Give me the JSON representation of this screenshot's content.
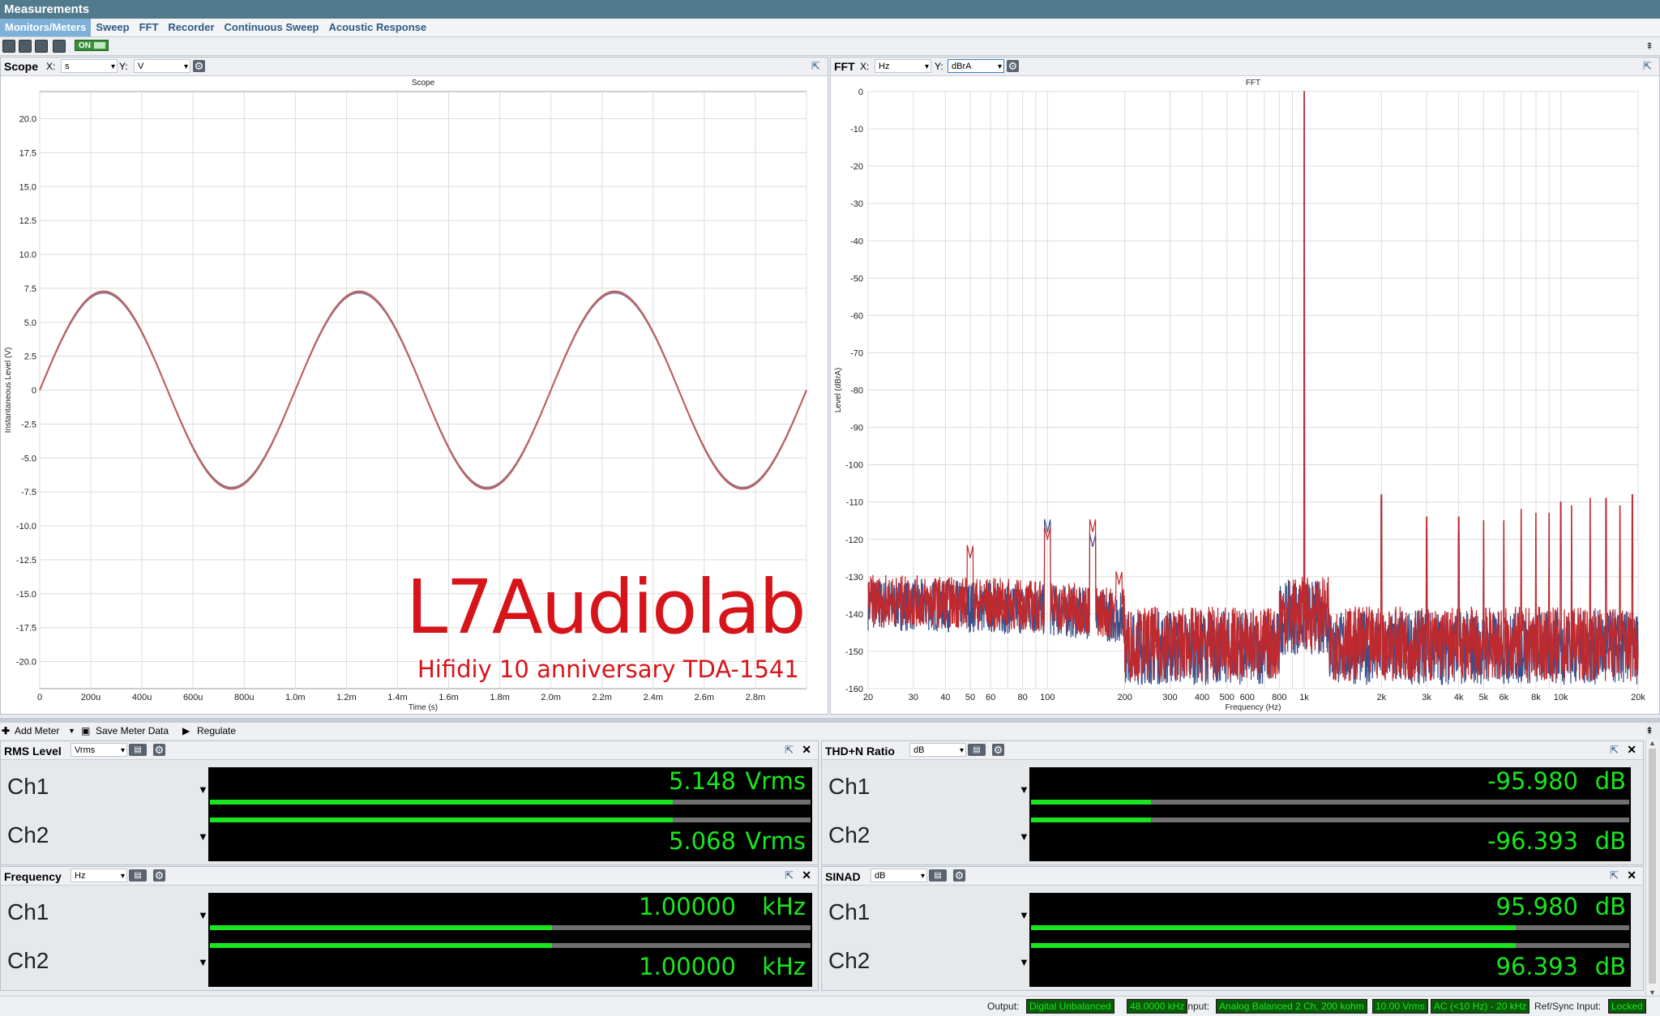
{
  "app": {
    "title": "Measurements"
  },
  "menu": [
    "Monitors/Meters",
    "Sweep",
    "FFT",
    "Recorder",
    "Continuous Sweep",
    "Acoustic Response"
  ],
  "toolbar": {
    "on_label": "ON"
  },
  "scope": {
    "title": "Scope",
    "x_unit": "s",
    "y_unit": "V",
    "x_label": "X:",
    "y_label": "Y:",
    "watermark": "L7Audiolab",
    "watermark_sub": "Hifidiy 10 anniversary TDA-1541"
  },
  "fft": {
    "title": "FFT",
    "x_unit": "Hz",
    "y_unit": "dBrA",
    "x_label": "X:",
    "y_label": "Y:"
  },
  "chart_data": [
    {
      "type": "line",
      "title": "Scope",
      "xlabel": "Time (s)",
      "ylabel": "Instantaneous Level (V)",
      "xlim": [
        0,
        0.003
      ],
      "ylim": [
        -22,
        22
      ],
      "x_ticks": [
        "0",
        "200u",
        "400u",
        "600u",
        "800u",
        "1.0m",
        "1.2m",
        "1.4m",
        "1.6m",
        "1.8m",
        "2.0m",
        "2.2m",
        "2.4m",
        "2.6m",
        "2.8m"
      ],
      "y_ticks": [
        "20.0",
        "17.5",
        "15.0",
        "12.5",
        "10.0",
        "7.5",
        "5.0",
        "2.5",
        "0",
        "-2.5",
        "-5.0",
        "-7.5",
        "-10.0",
        "-12.5",
        "-15.0",
        "-17.5",
        "-20.0"
      ],
      "grid": true,
      "series": [
        {
          "frequency_hz": 1000,
          "amplitude_v": 7.28,
          "color": "#c0605e"
        },
        {
          "frequency_hz": 1000,
          "amplitude_v": 7.17,
          "color": "#8a7a96"
        }
      ]
    },
    {
      "type": "line",
      "title": "FFT",
      "xlabel": "Frequency (Hz)",
      "ylabel": "Level (dBrA)",
      "x_scale": "log",
      "xlim": [
        20,
        20000
      ],
      "ylim": [
        -160,
        0
      ],
      "x_ticks": [
        "20",
        "30",
        "40",
        "50",
        "60",
        "80",
        "100",
        "200",
        "300",
        "400",
        "500",
        "600",
        "800",
        "1k",
        "2k",
        "3k",
        "4k",
        "5k",
        "6k",
        "8k",
        "10k",
        "20k"
      ],
      "y_ticks": [
        "0",
        "-10",
        "-20",
        "-30",
        "-40",
        "-50",
        "-60",
        "-70",
        "-80",
        "-90",
        "-100",
        "-110",
        "-120",
        "-130",
        "-140",
        "-150",
        "-160"
      ],
      "grid": true,
      "series": [
        {
          "color": "#c0292d",
          "fundamental": [
            1000,
            0
          ],
          "harmonics": [
            [
              2000,
              -108
            ],
            [
              3000,
              -114
            ],
            [
              4000,
              -114
            ],
            [
              5000,
              -115
            ],
            [
              6000,
              -115
            ],
            [
              7000,
              -112
            ],
            [
              8000,
              -113
            ],
            [
              9000,
              -113
            ],
            [
              10000,
              -110
            ],
            [
              11000,
              -111
            ],
            [
              13000,
              -109
            ],
            [
              15000,
              -109
            ],
            [
              17000,
              -111
            ],
            [
              19000,
              -108
            ]
          ],
          "noise_floor_db": -146,
          "low_freq_spurs": [
            [
              50,
              -125
            ],
            [
              60,
              -148
            ],
            [
              100,
              -120
            ],
            [
              150,
              -118
            ],
            [
              190,
              -132
            ]
          ]
        },
        {
          "color": "#3a4f8a",
          "fundamental": [
            1000,
            0
          ],
          "harmonics": [
            [
              2000,
              -109
            ],
            [
              3000,
              -117
            ],
            [
              4000,
              -118
            ],
            [
              5000,
              -120
            ]
          ],
          "noise_floor_db": -147,
          "low_freq_spurs": [
            [
              100,
              -118
            ],
            [
              150,
              -122
            ]
          ]
        }
      ]
    }
  ],
  "meter_toolbar": {
    "add_meter": "Add Meter",
    "save": "Save Meter Data",
    "regulate": "Regulate"
  },
  "meters": [
    {
      "title": "RMS Level",
      "unit_select": "Vrms",
      "ch": [
        {
          "label": "Ch1",
          "value": "5.148",
          "unit": "Vrms",
          "fill": 0.77
        },
        {
          "label": "Ch2",
          "value": "5.068",
          "unit": "Vrms",
          "fill": 0.77
        }
      ]
    },
    {
      "title": "THD+N Ratio",
      "unit_select": "dB",
      "ch": [
        {
          "label": "Ch1",
          "value": "-95.980",
          "unit": "dB",
          "fill": 0.2
        },
        {
          "label": "Ch2",
          "value": "-96.393",
          "unit": "dB",
          "fill": 0.2
        }
      ]
    },
    {
      "title": "Frequency",
      "unit_select": "Hz",
      "ch": [
        {
          "label": "Ch1",
          "value": "1.00000",
          "unit": "kHz",
          "fill": 0.57
        },
        {
          "label": "Ch2",
          "value": "1.00000",
          "unit": "kHz",
          "fill": 0.57
        }
      ]
    },
    {
      "title": "SINAD",
      "unit_select": "dB",
      "ch": [
        {
          "label": "Ch1",
          "value": "95.980",
          "unit": "dB",
          "fill": 0.81
        },
        {
          "label": "Ch2",
          "value": "96.393",
          "unit": "dB",
          "fill": 0.81
        }
      ]
    }
  ],
  "status": {
    "output_label": "Output:",
    "output_conn": "Digital Unbalanced",
    "output_rate": "48.0000 kHz",
    "input_label": "Input:",
    "input_conn": "Analog Balanced 2 Ch, 200 kohm",
    "input_range": "10.00 Vrms",
    "input_filter": "AC (<10 Hz) - 20 kHz",
    "ref_label": "Ref/Sync Input:",
    "ref_state": "Locked"
  }
}
